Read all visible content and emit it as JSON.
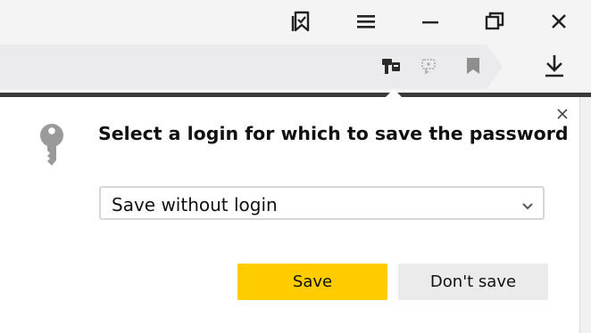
{
  "window_controls": {
    "collections_icon": "bookmark-collections-icon",
    "menu_icon": "hamburger-menu-icon",
    "minimize_icon": "minimize-icon",
    "restore_icon": "restore-icon",
    "close_icon": "close-icon"
  },
  "address_bar": {
    "icons": [
      "password-key-icon",
      "protect-icon",
      "bookmark-icon"
    ],
    "download_icon": "download-icon"
  },
  "password_popup": {
    "title": "Select a login for which to save the password",
    "login_select": {
      "selected_value": "Save without login"
    },
    "save_button_label": "Save",
    "dont_save_button_label": "Don't save"
  },
  "colors": {
    "save_button": "#ffcc00",
    "dont_save_button": "#ebebeb",
    "title_bar": "#f4f4f5",
    "icon_gray": "#9a9a9a"
  }
}
